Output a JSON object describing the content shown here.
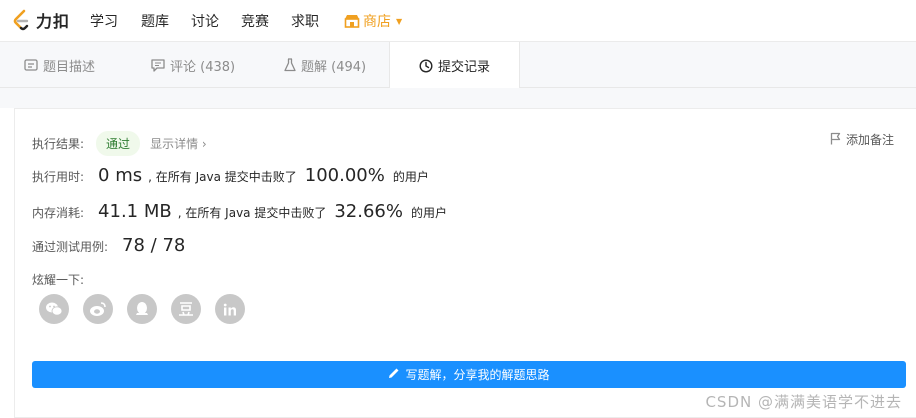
{
  "brand": {
    "name": "力扣"
  },
  "nav": {
    "items": [
      "学习",
      "题库",
      "讨论",
      "竞赛",
      "求职"
    ],
    "shop": "商店"
  },
  "tabs": [
    {
      "label": "题目描述"
    },
    {
      "label": "评论 (438)"
    },
    {
      "label": "题解 (494)"
    },
    {
      "label": "提交记录"
    }
  ],
  "result": {
    "exec_label": "执行结果:",
    "status": "通过",
    "details_link": "显示详情 ›",
    "add_note": "添加备注",
    "time_label": "执行用时:",
    "time_value": "0 ms",
    "time_text": ", 在所有 Java 提交中击败了",
    "time_pct": "100.00%",
    "time_suffix": "的用户",
    "mem_label": "内存消耗:",
    "mem_value": "41.1 MB",
    "mem_text": ", 在所有 Java 提交中击败了",
    "mem_pct": "32.66%",
    "mem_suffix": "的用户",
    "tests_label": "通过测试用例:",
    "tests_value": "78 / 78",
    "share_label": "炫耀一下:"
  },
  "share_icons": [
    "wechat-icon",
    "weibo-icon",
    "qq-icon",
    "douban-icon",
    "linkedin-icon"
  ],
  "write_button": "写题解，分享我的解题思路",
  "watermark": "CSDN @满满美语学不进去",
  "colors": {
    "accent": "#1a90ff",
    "pass_bg": "#f0f9eb",
    "pass_text": "#2f7d32",
    "shop": "#f0a020"
  }
}
